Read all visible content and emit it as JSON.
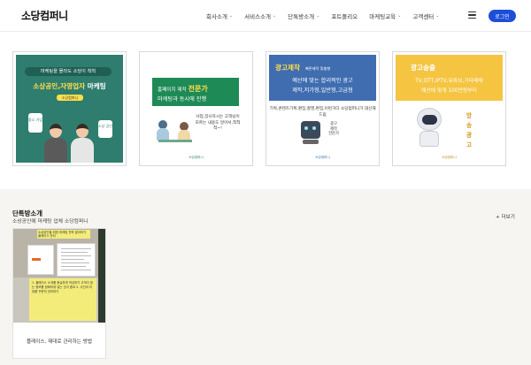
{
  "header": {
    "logo": "소당컴퍼니",
    "nav": [
      {
        "label": "회사소개",
        "chevron": "⌄"
      },
      {
        "label": "서비스소개",
        "chevron": "⌄"
      },
      {
        "label": "단톡방소개",
        "chevron": "⌄"
      },
      {
        "label": "포트폴리오",
        "chevron": ""
      },
      {
        "label": "마케팅교육",
        "chevron": "⌄"
      },
      {
        "label": "고객센터",
        "chevron": "⌄"
      }
    ],
    "menu_icon": "hamburger-icon",
    "login_label": "로그인",
    "accent_color": "#1d4ed8"
  },
  "banners": [
    {
      "pill": "마케팅을 몰라도 소당이 척척",
      "headline_yellow": "소상공인,자영업자",
      "headline_white": " 마케팅",
      "brand_tag": "소당컴퍼니",
      "left_badge": "중소 기업",
      "right_badge": "소상 공인",
      "color": "#2f7d6e"
    },
    {
      "line1": "홈페이지 제작",
      "line1_highlight": "전문가",
      "line2": "마케팅과 동시에 진행",
      "bubble": "사업,장사하시는 고객님이 모르는 내용도 알아서,척척척~!",
      "footer": "소당컴퍼니",
      "color": "#1e8a56"
    },
    {
      "title": "광고제작",
      "title_tags": "빠른제작    맞춤형",
      "line1": "예산에 맞는 합리적인 광고",
      "line2": "제작,저가형,일반형,고급형",
      "desc": "기획,콘텐츠기획,편집,촬영,편집,이런거다 소당컴퍼니가 대신해 드림",
      "robot_text": "광고 제작 전문가",
      "footer": "소당컴퍼니",
      "color": "#3f6db0"
    },
    {
      "title": "광고송출",
      "line1": "TV,OTT,IPTV,유튜브,기타매체",
      "line2": "예산에 맞게  100만원부터",
      "vertical": [
        "방",
        "송",
        "광",
        "고"
      ],
      "footer": "소당컴퍼니",
      "color": "#f5c542"
    }
  ],
  "broadcast": {
    "title": "단톡방소개",
    "subtitle": "소상공인에 마케팅 업체 소당컴퍼니",
    "more_label": "+ 더보기",
    "cards": [
      {
        "caption": "플레이스, 제대로 관리하는 방법",
        "sticky_top": "소상공인을 위한 마케팅 전략 알아보기 플레이스 관리",
        "sticky_note": "1. 플레이스 소개를 충실하게 작성하기 고객이 찾는 정보를 정확하게 넣는 것이 중요 2. 사진과 리뷰를 꾸준히 관리하기"
      }
    ]
  }
}
